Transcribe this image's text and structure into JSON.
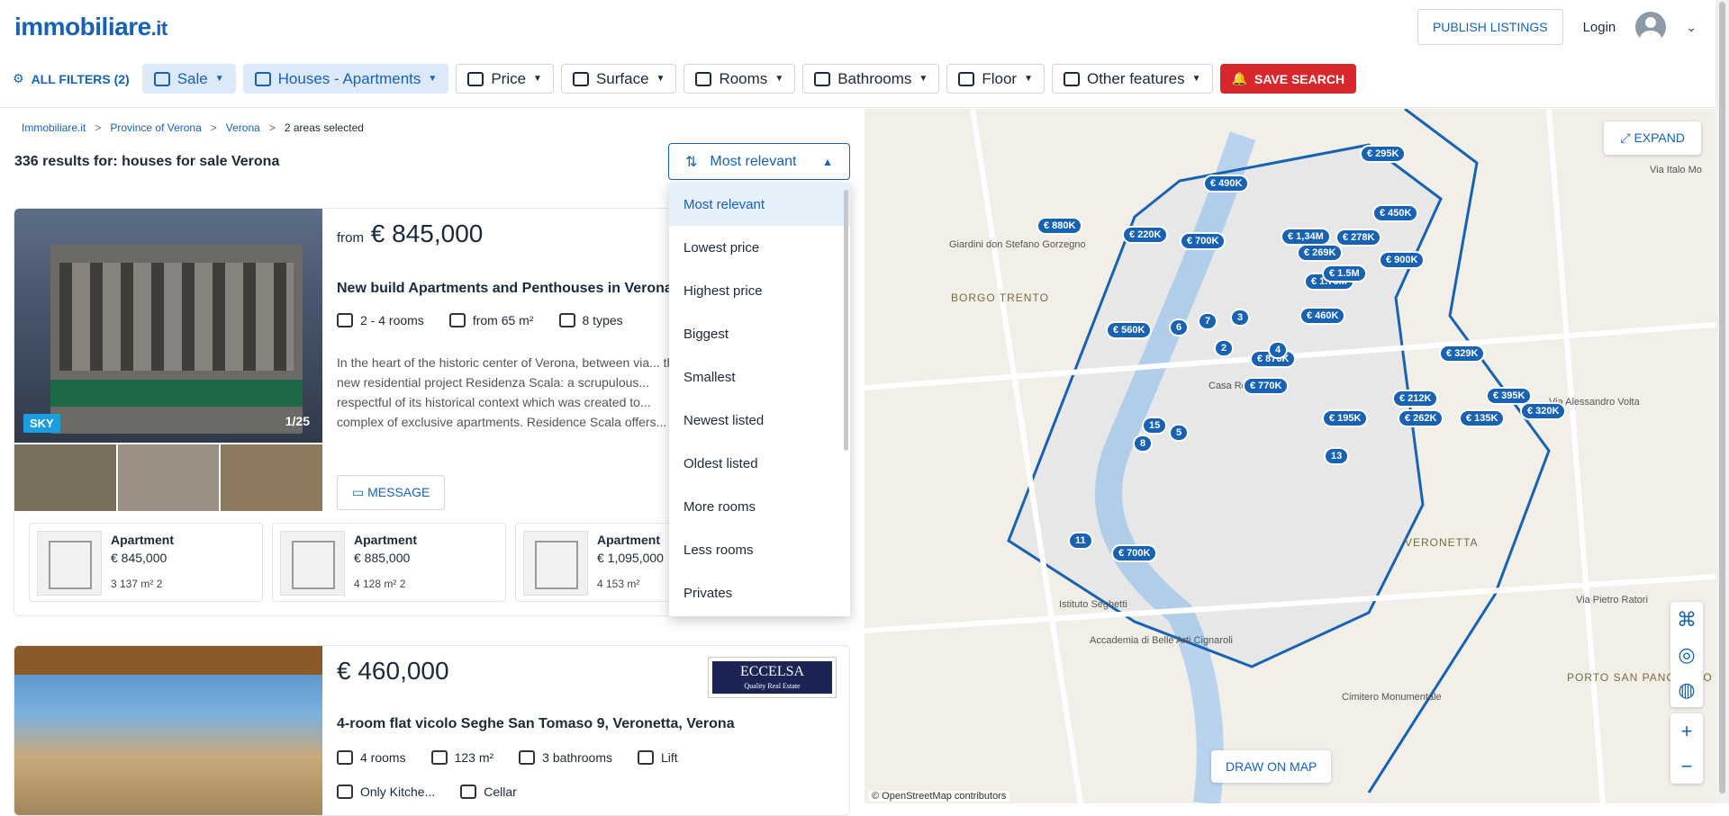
{
  "header": {
    "logo": "immobiliare",
    "logo_suffix": ".it",
    "publish_label": "PUBLISH LISTINGS",
    "login_label": "Login",
    "chevron": "⌄"
  },
  "filters": {
    "all": "ALL FILTERS (2)",
    "sale": "Sale",
    "type": "Houses - Apartments",
    "price": "Price",
    "surface": "Surface",
    "rooms": "Rooms",
    "bathrooms": "Bathrooms",
    "floor": "Floor",
    "other": "Other features",
    "save": "SAVE SEARCH"
  },
  "breadcrumb": {
    "items": [
      "Immobiliare.it",
      "Province of Verona",
      "Verona",
      "2 areas selected"
    ],
    "sep": ">"
  },
  "results_label": "336 results for: houses for sale Verona",
  "sort": {
    "selected": "Most relevant",
    "options": [
      "Most relevant",
      "Lowest price",
      "Highest price",
      "Biggest",
      "Smallest",
      "Newest listed",
      "Oldest listed",
      "More rooms",
      "Less rooms",
      "Privates"
    ]
  },
  "listing1": {
    "tag": "SKY",
    "counter": "1/25",
    "price_prefix": "from",
    "price": "€ 845,000",
    "title": "New build Apartments and Penthouses in Verona",
    "features": [
      "2 - 4 rooms",
      "from 65 m²",
      "8 types"
    ],
    "description": "In the heart of the historic center of Verona, between via... the new residential project Residenza Scala: a scrupulous... respectful of its historical context which was created to... complex of exclusive apartments. Residence Scala offers...",
    "message": "MESSAGE",
    "units": [
      {
        "type": "Apartment",
        "price": "€ 845,000",
        "meta": "3   137 m²   2"
      },
      {
        "type": "Apartment",
        "price": "€ 885,000",
        "meta": "4   128 m²   2"
      },
      {
        "type": "Apartment",
        "price": "€ 1,095,000",
        "meta": "4   153 m²"
      }
    ]
  },
  "listing2": {
    "price": "€ 460,000",
    "agency": "ECCELSA",
    "agency_sub": "Quality Real Estate",
    "title": "4-room flat vicolo Seghe San Tomaso 9, Veronetta, Verona",
    "features": [
      "4 rooms",
      "123 m²",
      "3 bathrooms",
      "Lift"
    ],
    "features2": [
      "Only Kitche...",
      "Cellar"
    ]
  },
  "map": {
    "expand": "EXPAND",
    "draw": "DRAW ON MAP",
    "attribution": "© OpenStreetMap contributors",
    "zoom_in": "+",
    "zoom_out": "−",
    "labels": [
      "BORGO TRENTO",
      "VERONETTA",
      "PORTO SAN PANCRAZIO",
      "Casa Romeo",
      "Giardini don Stefano Gorzegno",
      "Istituto Seghetti",
      "Accademia di Belle Arti Cignaroli",
      "Cimitero Monumentale",
      "Via Italo Mo",
      "Via Alessandro Volta",
      "Via Pietro Ratori"
    ],
    "pins": [
      "€ 295K",
      "€ 490K",
      "€ 450K",
      "€ 880K",
      "€ 220K",
      "€ 700K",
      "€ 1,34M",
      "€ 278K",
      "€ 269K",
      "€ 900K",
      "€ 1.75M",
      "€ 1.5M",
      "€ 460K",
      "€ 560K",
      "€ 870K",
      "€ 329K",
      "€ 770K",
      "€ 212K",
      "€ 395K",
      "€ 195K",
      "€ 262K",
      "€ 135K",
      "€ 320K",
      "€ 700K",
      "6",
      "7",
      "3",
      "2",
      "4",
      "5",
      "8",
      "15",
      "13",
      "11"
    ]
  }
}
